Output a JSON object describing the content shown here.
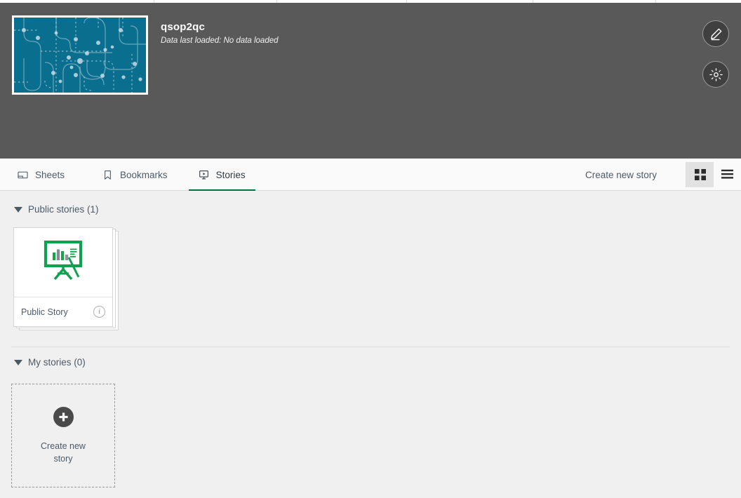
{
  "browser": {
    "tab_segments": [
      220,
      175,
      185,
      180,
      175
    ]
  },
  "header": {
    "app_title": "qsop2qc",
    "data_status": "Data last loaded: No data loaded",
    "thumbnail_icon": "app-thumbnail-pattern",
    "thumbnail_bg": "#0a6e8f",
    "background": "#595959",
    "edit_button": "edit-pencil-icon",
    "settings_button": "settings-gear-icon"
  },
  "toolbar": {
    "tabs": [
      {
        "label": "Sheets",
        "icon": "sheet-icon",
        "active": false
      },
      {
        "label": "Bookmarks",
        "icon": "bookmark-icon",
        "active": false
      },
      {
        "label": "Stories",
        "icon": "story-icon",
        "active": true
      }
    ],
    "create_link": "Create new story",
    "grid_view_icon": "grid-view-icon",
    "list_view_icon": "list-view-icon",
    "active_view": "grid",
    "accent_color": "#00713c"
  },
  "content": {
    "sections": [
      {
        "title": "Public stories (1)",
        "expanded": true
      },
      {
        "title": "My stories (0)",
        "expanded": true
      }
    ],
    "public_stories": [
      {
        "name": "Public Story",
        "thumb_icon": "story-easel-icon",
        "info_icon": "info-icon",
        "info_glyph": "i"
      }
    ],
    "create_card": {
      "label": "Create new story",
      "icon": "plus-circle-icon"
    }
  }
}
